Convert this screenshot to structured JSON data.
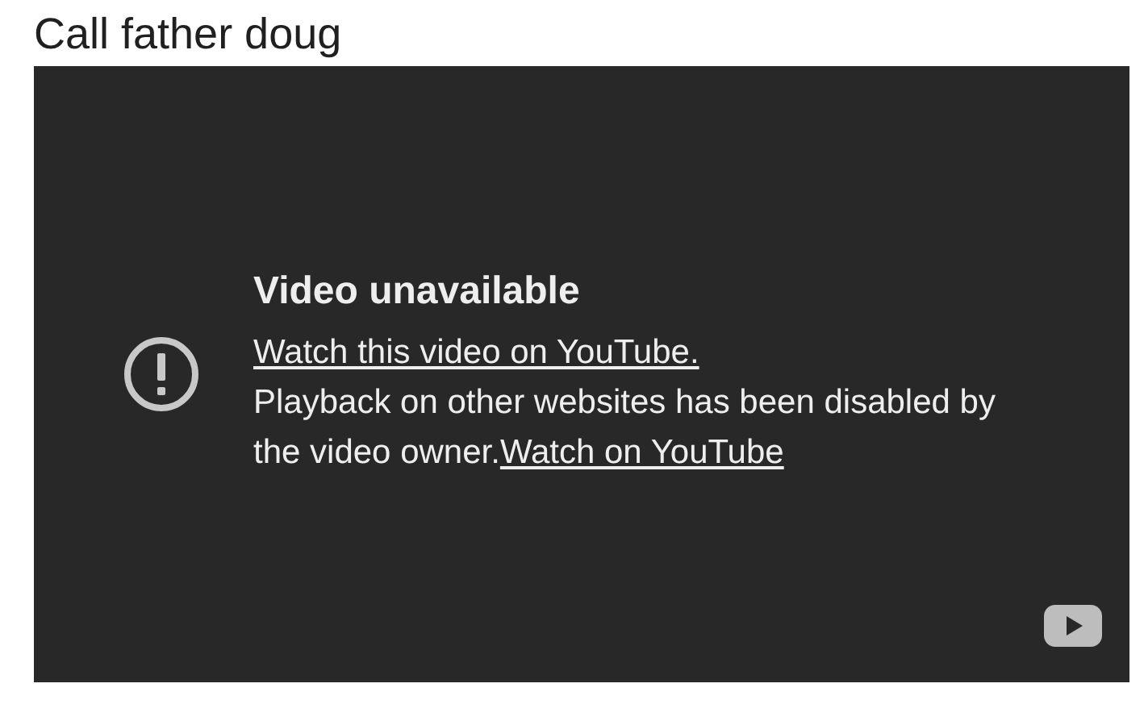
{
  "title": "Call father doug",
  "video": {
    "heading": "Video unavailable",
    "link": "Watch this video on YouTube.",
    "message": "Playback on other websites has been disabled by the video owner.",
    "message_link": "Watch on YouTube"
  }
}
